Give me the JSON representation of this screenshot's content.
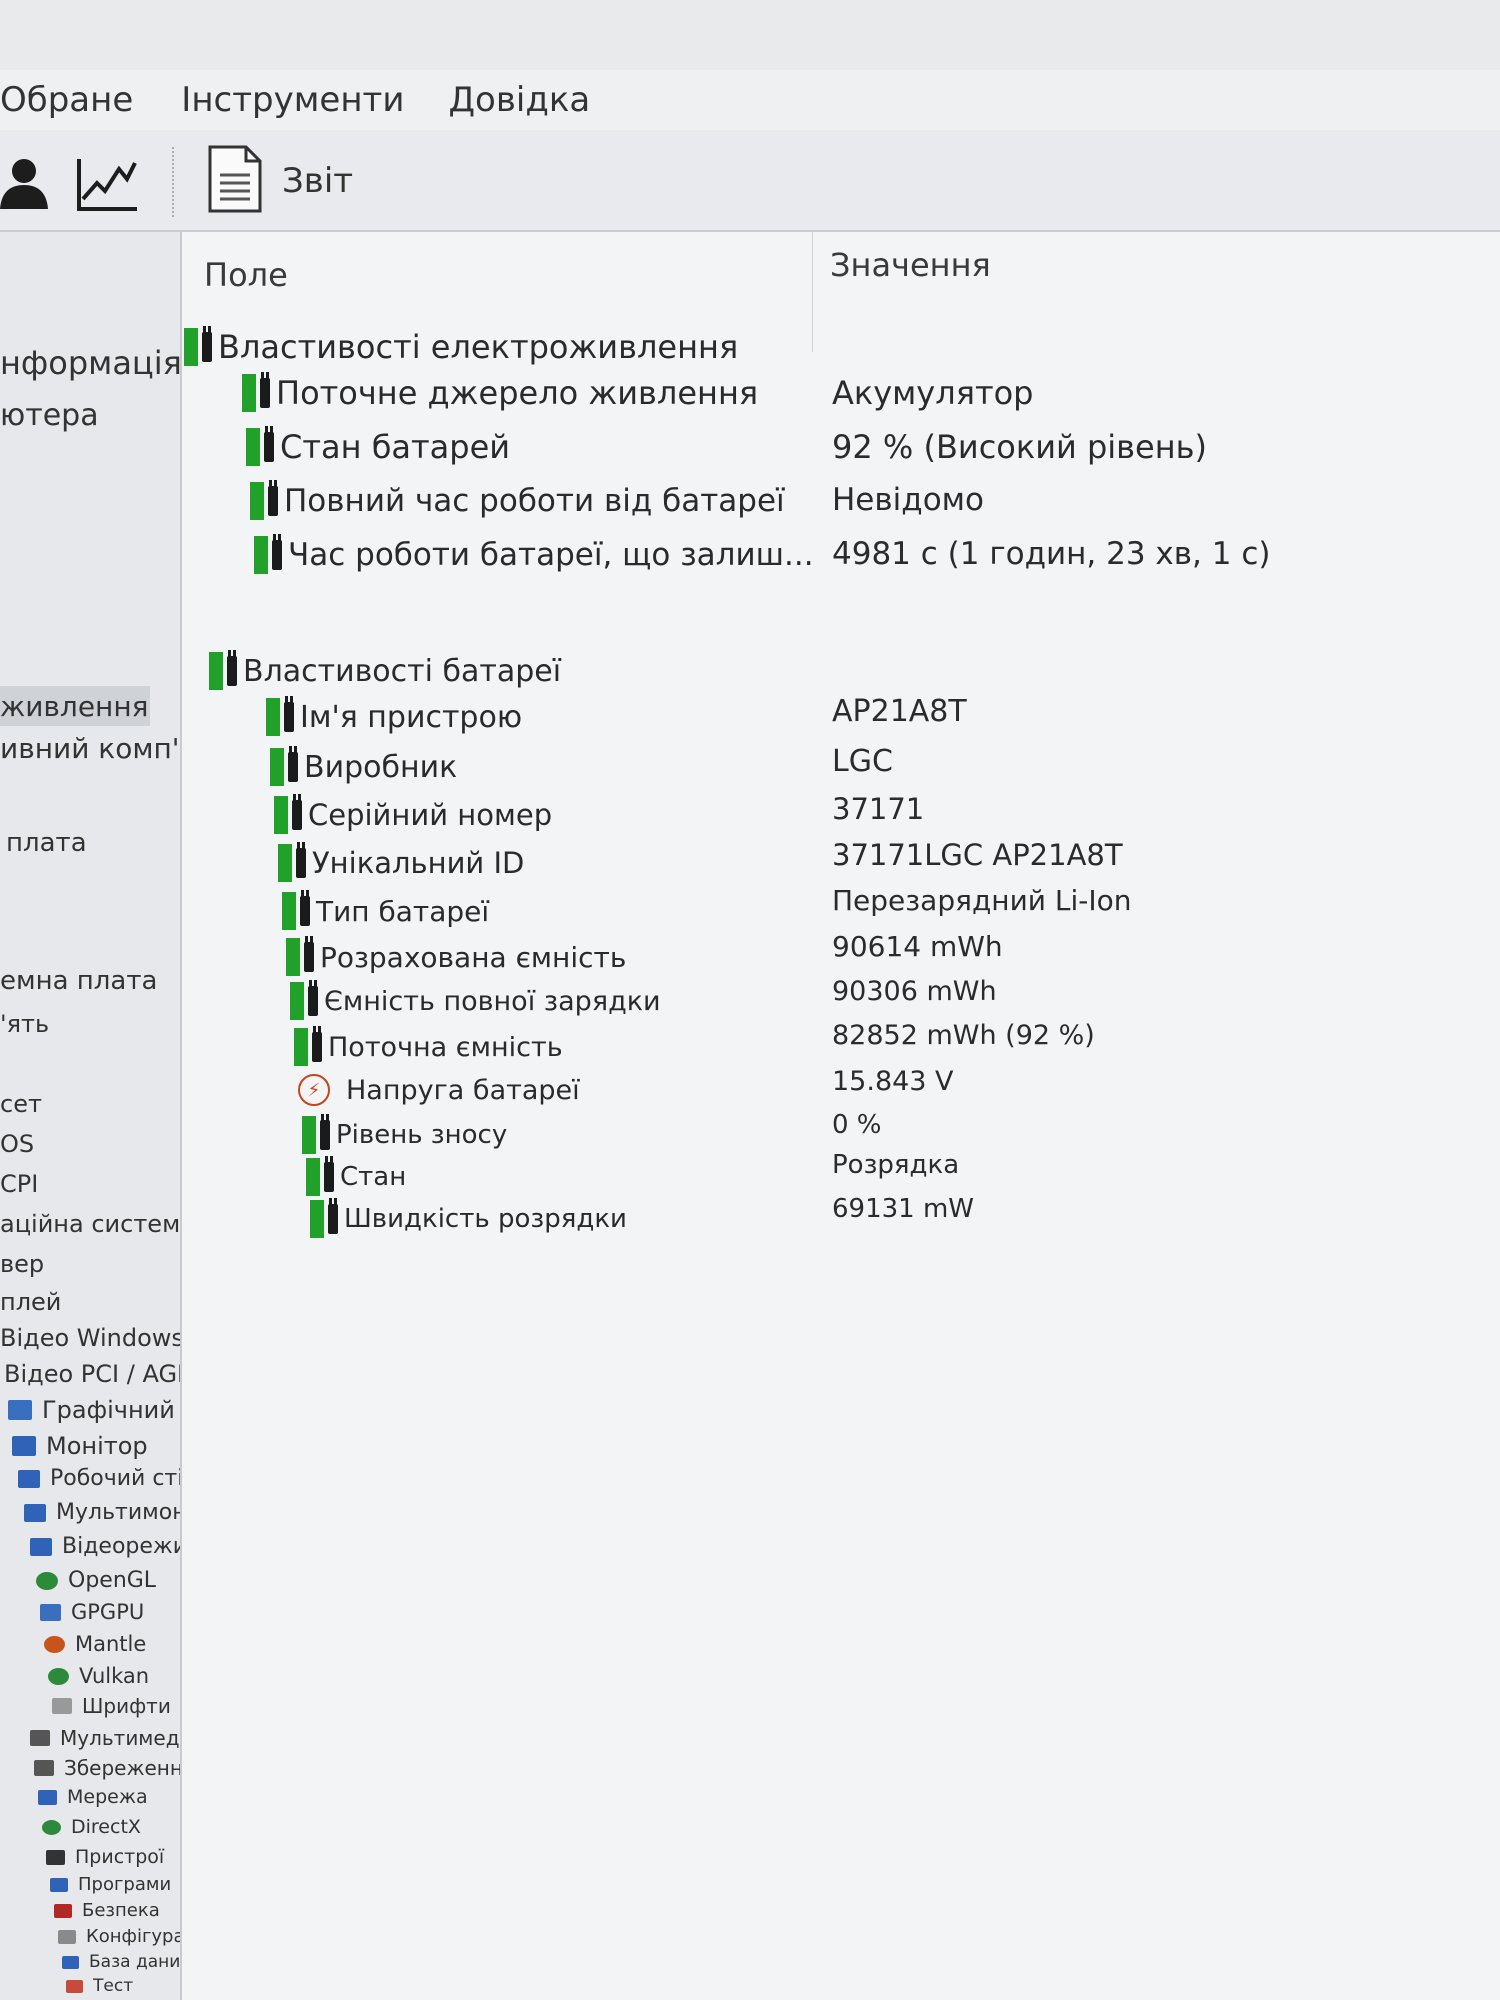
{
  "menu": [
    "Обране",
    "Інструменти",
    "Довідка"
  ],
  "toolbar": {
    "report_label": "Звіт"
  },
  "columns": {
    "field": "Поле",
    "value": "Значення"
  },
  "groups": [
    {
      "title": "Властивості електроживлення",
      "rows": [
        {
          "field": "Поточне джерело живлення",
          "value": "Акумулятор",
          "icon": "battery-plug-icon"
        },
        {
          "field": "Стан батарей",
          "value": "92 % (Високий рівень)",
          "icon": "battery-plug-icon"
        },
        {
          "field": "Повний час роботи від батареї",
          "value": "Невідомо",
          "icon": "battery-plug-icon"
        },
        {
          "field": "Час роботи батареї, що залиш...",
          "value": "4981 с (1 годин, 23 хв, 1 с)",
          "icon": "battery-plug-icon"
        }
      ]
    },
    {
      "title": "Властивості батареї",
      "rows": [
        {
          "field": "Ім'я пристрою",
          "value": "AP21A8T",
          "icon": "battery-plug-icon"
        },
        {
          "field": "Виробник",
          "value": "LGC",
          "icon": "battery-plug-icon"
        },
        {
          "field": "Серійний номер",
          "value": "37171",
          "icon": "battery-plug-icon"
        },
        {
          "field": "Унікальний ID",
          "value": "37171LGC AP21A8T",
          "icon": "battery-plug-icon"
        },
        {
          "field": "Тип батареї",
          "value": "Перезарядний Li-Ion",
          "icon": "battery-plug-icon"
        },
        {
          "field": "Розрахована ємність",
          "value": "90614 mWh",
          "icon": "battery-plug-icon"
        },
        {
          "field": "Ємність повної зарядки",
          "value": "90306 mWh",
          "icon": "battery-plug-icon"
        },
        {
          "field": "Поточна ємність",
          "value": "82852 mWh  (92 %)",
          "icon": "battery-plug-icon"
        },
        {
          "field": "Напруга батареї",
          "value": "15.843 V",
          "icon": "voltage-icon"
        },
        {
          "field": "Рівень зносу",
          "value": "0 %",
          "icon": "battery-plug-icon"
        },
        {
          "field": "Стан",
          "value": "Розрядка",
          "icon": "battery-plug-icon"
        },
        {
          "field": "Швидкість розрядки",
          "value": "69131 mW",
          "icon": "battery-plug-icon"
        }
      ]
    }
  ],
  "sidebar": [
    {
      "label": "нформація"
    },
    {
      "label": "ютера"
    },
    {
      "label": "живлення",
      "selected": true
    },
    {
      "label": "ивний комп'ют"
    },
    {
      "label": "плата"
    },
    {
      "label": "емна плата"
    },
    {
      "label": "'ять"
    },
    {
      "label": "сет"
    },
    {
      "label": "OS"
    },
    {
      "label": "CPI"
    },
    {
      "label": "аційна система"
    },
    {
      "label": "вер"
    },
    {
      "label": "плей"
    },
    {
      "label": "Відео Windows"
    },
    {
      "label": "Відео PCI / AGP"
    },
    {
      "label": "Графічний процесор"
    },
    {
      "label": "Монітор"
    },
    {
      "label": "Робочий стіл"
    },
    {
      "label": "Мультимонітор"
    },
    {
      "label": "Відеорежими"
    },
    {
      "label": "OpenGL"
    },
    {
      "label": "GPGPU"
    },
    {
      "label": "Mantle"
    },
    {
      "label": "Vulkan"
    },
    {
      "label": "Шрифти"
    },
    {
      "label": "Мультимедіа"
    },
    {
      "label": "Збереження даних"
    },
    {
      "label": "Мережа"
    },
    {
      "label": "DirectX"
    },
    {
      "label": "Пристрої"
    },
    {
      "label": "Програми"
    },
    {
      "label": "Безпека"
    },
    {
      "label": "Конфігурація"
    },
    {
      "label": "База даних"
    },
    {
      "label": "Тест"
    }
  ]
}
